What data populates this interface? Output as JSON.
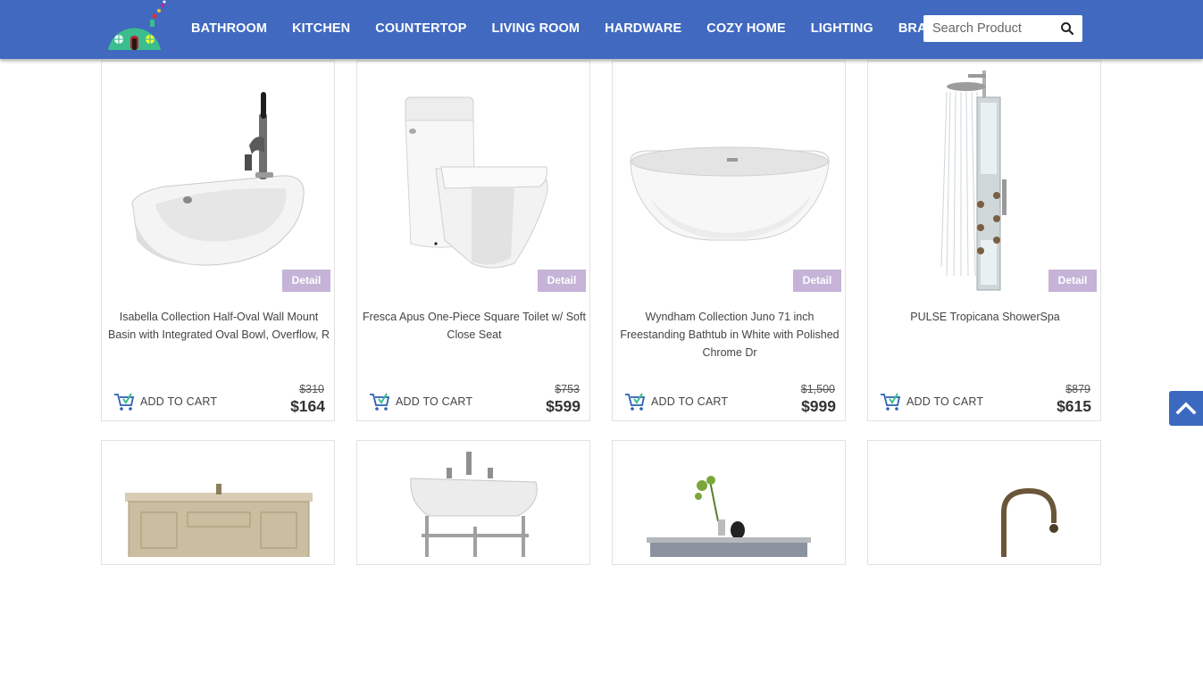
{
  "nav": {
    "items": [
      "BATHROOM",
      "KITCHEN",
      "COUNTERTOP",
      "LIVING ROOM",
      "HARDWARE",
      "COZY HOME",
      "LIGHTING",
      "BRANDS"
    ]
  },
  "search": {
    "placeholder": "Search Product"
  },
  "products": [
    {
      "title": "Isabella Collection Half-Oval Wall Mount Basin with Integrated Oval Bowl, Overflow, R",
      "detail_label": "Detail",
      "cart_label": "ADD TO CART",
      "old_price": "$310",
      "price": "$164"
    },
    {
      "title": "Fresca Apus One-Piece Square Toilet w/ Soft Close Seat",
      "detail_label": "Detail",
      "cart_label": "ADD TO CART",
      "old_price": "$753",
      "price": "$599"
    },
    {
      "title": "Wyndham Collection Juno 71 inch Freestanding Bathtub in White with Polished Chrome Dr",
      "detail_label": "Detail",
      "cart_label": "ADD TO CART",
      "old_price": "$1,500",
      "price": "$999"
    },
    {
      "title": "PULSE Tropicana ShowerSpa",
      "detail_label": "Detail",
      "cart_label": "ADD TO CART",
      "old_price": "$879",
      "price": "$615"
    }
  ],
  "colors": {
    "header": "#4069bf",
    "detail_badge": "#c5b3d8",
    "back_to_top": "#3c69c0"
  }
}
